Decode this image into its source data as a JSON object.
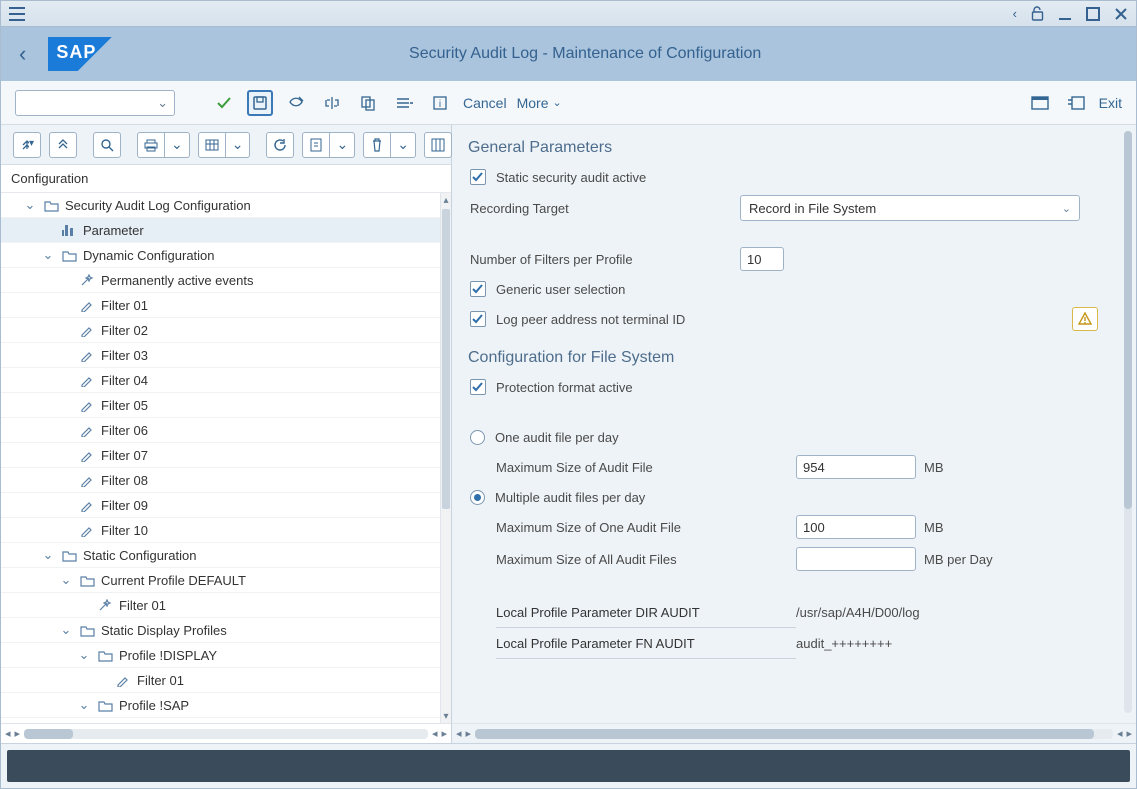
{
  "window": {
    "title": "Security Audit Log - Maintenance of Configuration"
  },
  "toolbar": {
    "cancel": "Cancel",
    "more": "More",
    "exit": "Exit"
  },
  "tree": {
    "header": "Configuration",
    "nodes": [
      {
        "level": 1,
        "expand": "open",
        "icon": "folder",
        "label": "Security Audit Log Configuration",
        "selected": false
      },
      {
        "level": 2,
        "expand": "leaf",
        "icon": "param",
        "label": "Parameter",
        "selected": true
      },
      {
        "level": 2,
        "expand": "open",
        "icon": "folder",
        "label": "Dynamic Configuration"
      },
      {
        "level": 3,
        "expand": "leaf",
        "icon": "wand",
        "label": "Permanently active events"
      },
      {
        "level": 3,
        "expand": "leaf",
        "icon": "pencil",
        "label": "Filter 01"
      },
      {
        "level": 3,
        "expand": "leaf",
        "icon": "pencil",
        "label": "Filter 02"
      },
      {
        "level": 3,
        "expand": "leaf",
        "icon": "pencil",
        "label": "Filter 03"
      },
      {
        "level": 3,
        "expand": "leaf",
        "icon": "pencil",
        "label": "Filter 04"
      },
      {
        "level": 3,
        "expand": "leaf",
        "icon": "pencil",
        "label": "Filter 05"
      },
      {
        "level": 3,
        "expand": "leaf",
        "icon": "pencil",
        "label": "Filter 06"
      },
      {
        "level": 3,
        "expand": "leaf",
        "icon": "pencil",
        "label": "Filter 07"
      },
      {
        "level": 3,
        "expand": "leaf",
        "icon": "pencil",
        "label": "Filter 08"
      },
      {
        "level": 3,
        "expand": "leaf",
        "icon": "pencil",
        "label": "Filter 09"
      },
      {
        "level": 3,
        "expand": "leaf",
        "icon": "pencil",
        "label": "Filter 10"
      },
      {
        "level": 2,
        "expand": "open",
        "icon": "folder",
        "label": "Static Configuration"
      },
      {
        "level": 3,
        "expand": "open",
        "icon": "folder",
        "label": "Current Profile DEFAULT"
      },
      {
        "level": 4,
        "expand": "leaf",
        "icon": "wand",
        "label": "Filter 01"
      },
      {
        "level": 3,
        "expand": "open",
        "icon": "folder",
        "label": "Static Display Profiles"
      },
      {
        "level": 4,
        "expand": "open",
        "icon": "folder",
        "label": "Profile !DISPLAY"
      },
      {
        "level": 5,
        "expand": "leaf",
        "icon": "pencil",
        "label": "Filter 01"
      },
      {
        "level": 4,
        "expand": "open",
        "icon": "folder",
        "label": "Profile !SAP"
      }
    ]
  },
  "general": {
    "title": "General Parameters",
    "static_active_label": "Static security audit active",
    "static_active": true,
    "recording_target_label": "Recording Target",
    "recording_target_value": "Record in File System",
    "num_filters_label": "Number of Filters per Profile",
    "num_filters_value": "10",
    "generic_user_label": "Generic user selection",
    "generic_user": true,
    "log_peer_label": "Log peer address not terminal ID",
    "log_peer": true
  },
  "filecfg": {
    "title": "Configuration for File System",
    "protection_label": "Protection format active",
    "protection": true,
    "one_per_day_label": "One audit file per day",
    "one_per_day": false,
    "max_size_label": "Maximum Size of Audit File",
    "max_size_value": "954",
    "max_size_unit": "MB",
    "multi_per_day_label": "Multiple audit files per day",
    "multi_per_day": true,
    "max_one_label": "Maximum Size of One Audit File",
    "max_one_value": "100",
    "max_one_unit": "MB",
    "max_all_label": "Maximum Size of All Audit Files",
    "max_all_value": "",
    "max_all_unit": "MB per Day",
    "dir_audit_label": "Local Profile Parameter DIR AUDIT",
    "dir_audit_value": "/usr/sap/A4H/D00/log",
    "fn_audit_label": "Local Profile Parameter FN AUDIT",
    "fn_audit_value": "audit_++++++++"
  }
}
